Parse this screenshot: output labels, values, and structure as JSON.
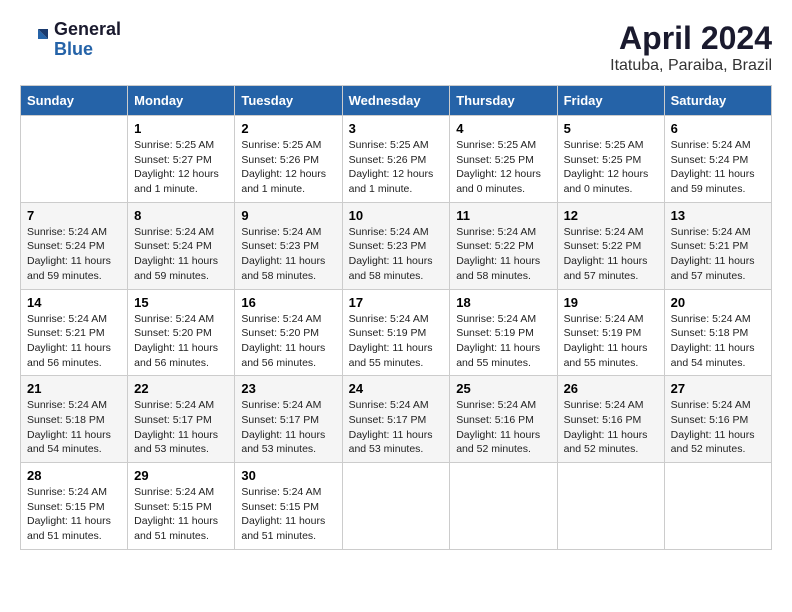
{
  "header": {
    "logo_general": "General",
    "logo_blue": "Blue",
    "month_title": "April 2024",
    "location": "Itatuba, Paraiba, Brazil"
  },
  "days_of_week": [
    "Sunday",
    "Monday",
    "Tuesday",
    "Wednesday",
    "Thursday",
    "Friday",
    "Saturday"
  ],
  "weeks": [
    [
      {
        "num": "",
        "info": ""
      },
      {
        "num": "1",
        "info": "Sunrise: 5:25 AM\nSunset: 5:27 PM\nDaylight: 12 hours\nand 1 minute."
      },
      {
        "num": "2",
        "info": "Sunrise: 5:25 AM\nSunset: 5:26 PM\nDaylight: 12 hours\nand 1 minute."
      },
      {
        "num": "3",
        "info": "Sunrise: 5:25 AM\nSunset: 5:26 PM\nDaylight: 12 hours\nand 1 minute."
      },
      {
        "num": "4",
        "info": "Sunrise: 5:25 AM\nSunset: 5:25 PM\nDaylight: 12 hours\nand 0 minutes."
      },
      {
        "num": "5",
        "info": "Sunrise: 5:25 AM\nSunset: 5:25 PM\nDaylight: 12 hours\nand 0 minutes."
      },
      {
        "num": "6",
        "info": "Sunrise: 5:24 AM\nSunset: 5:24 PM\nDaylight: 11 hours\nand 59 minutes."
      }
    ],
    [
      {
        "num": "7",
        "info": "Sunrise: 5:24 AM\nSunset: 5:24 PM\nDaylight: 11 hours\nand 59 minutes."
      },
      {
        "num": "8",
        "info": "Sunrise: 5:24 AM\nSunset: 5:24 PM\nDaylight: 11 hours\nand 59 minutes."
      },
      {
        "num": "9",
        "info": "Sunrise: 5:24 AM\nSunset: 5:23 PM\nDaylight: 11 hours\nand 58 minutes."
      },
      {
        "num": "10",
        "info": "Sunrise: 5:24 AM\nSunset: 5:23 PM\nDaylight: 11 hours\nand 58 minutes."
      },
      {
        "num": "11",
        "info": "Sunrise: 5:24 AM\nSunset: 5:22 PM\nDaylight: 11 hours\nand 58 minutes."
      },
      {
        "num": "12",
        "info": "Sunrise: 5:24 AM\nSunset: 5:22 PM\nDaylight: 11 hours\nand 57 minutes."
      },
      {
        "num": "13",
        "info": "Sunrise: 5:24 AM\nSunset: 5:21 PM\nDaylight: 11 hours\nand 57 minutes."
      }
    ],
    [
      {
        "num": "14",
        "info": "Sunrise: 5:24 AM\nSunset: 5:21 PM\nDaylight: 11 hours\nand 56 minutes."
      },
      {
        "num": "15",
        "info": "Sunrise: 5:24 AM\nSunset: 5:20 PM\nDaylight: 11 hours\nand 56 minutes."
      },
      {
        "num": "16",
        "info": "Sunrise: 5:24 AM\nSunset: 5:20 PM\nDaylight: 11 hours\nand 56 minutes."
      },
      {
        "num": "17",
        "info": "Sunrise: 5:24 AM\nSunset: 5:19 PM\nDaylight: 11 hours\nand 55 minutes."
      },
      {
        "num": "18",
        "info": "Sunrise: 5:24 AM\nSunset: 5:19 PM\nDaylight: 11 hours\nand 55 minutes."
      },
      {
        "num": "19",
        "info": "Sunrise: 5:24 AM\nSunset: 5:19 PM\nDaylight: 11 hours\nand 55 minutes."
      },
      {
        "num": "20",
        "info": "Sunrise: 5:24 AM\nSunset: 5:18 PM\nDaylight: 11 hours\nand 54 minutes."
      }
    ],
    [
      {
        "num": "21",
        "info": "Sunrise: 5:24 AM\nSunset: 5:18 PM\nDaylight: 11 hours\nand 54 minutes."
      },
      {
        "num": "22",
        "info": "Sunrise: 5:24 AM\nSunset: 5:17 PM\nDaylight: 11 hours\nand 53 minutes."
      },
      {
        "num": "23",
        "info": "Sunrise: 5:24 AM\nSunset: 5:17 PM\nDaylight: 11 hours\nand 53 minutes."
      },
      {
        "num": "24",
        "info": "Sunrise: 5:24 AM\nSunset: 5:17 PM\nDaylight: 11 hours\nand 53 minutes."
      },
      {
        "num": "25",
        "info": "Sunrise: 5:24 AM\nSunset: 5:16 PM\nDaylight: 11 hours\nand 52 minutes."
      },
      {
        "num": "26",
        "info": "Sunrise: 5:24 AM\nSunset: 5:16 PM\nDaylight: 11 hours\nand 52 minutes."
      },
      {
        "num": "27",
        "info": "Sunrise: 5:24 AM\nSunset: 5:16 PM\nDaylight: 11 hours\nand 52 minutes."
      }
    ],
    [
      {
        "num": "28",
        "info": "Sunrise: 5:24 AM\nSunset: 5:15 PM\nDaylight: 11 hours\nand 51 minutes."
      },
      {
        "num": "29",
        "info": "Sunrise: 5:24 AM\nSunset: 5:15 PM\nDaylight: 11 hours\nand 51 minutes."
      },
      {
        "num": "30",
        "info": "Sunrise: 5:24 AM\nSunset: 5:15 PM\nDaylight: 11 hours\nand 51 minutes."
      },
      {
        "num": "",
        "info": ""
      },
      {
        "num": "",
        "info": ""
      },
      {
        "num": "",
        "info": ""
      },
      {
        "num": "",
        "info": ""
      }
    ]
  ]
}
